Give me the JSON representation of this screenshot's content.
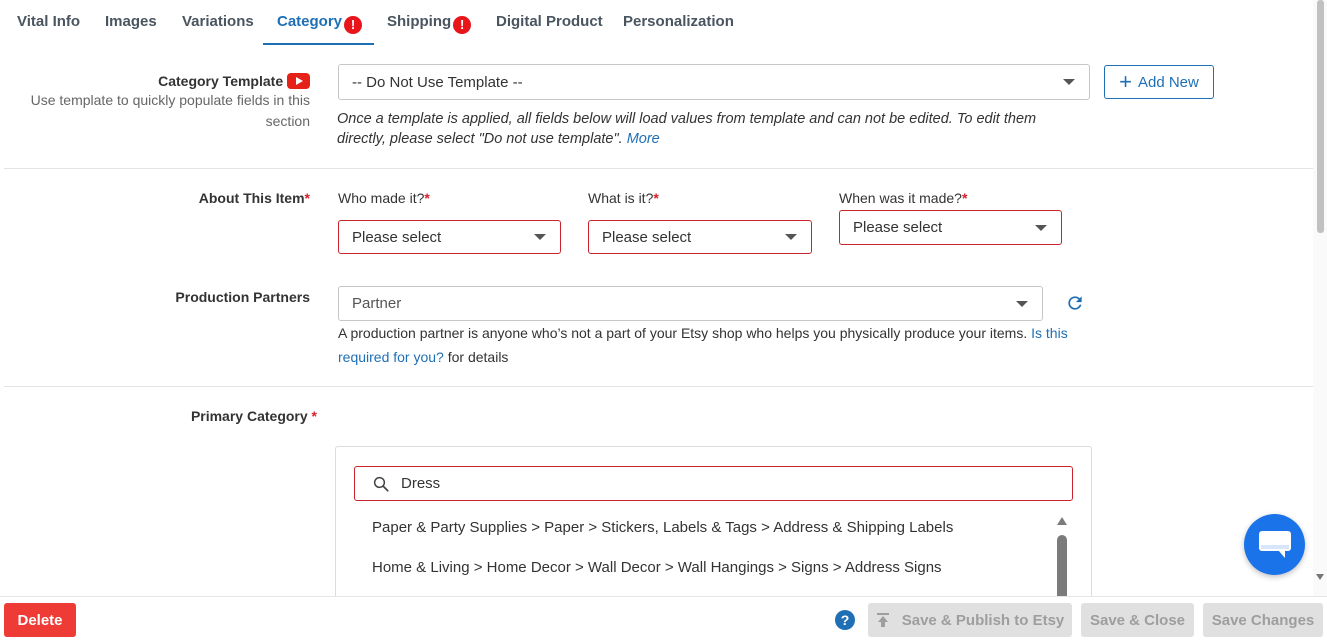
{
  "tabs": [
    {
      "label": "Vital Info"
    },
    {
      "label": "Images"
    },
    {
      "label": "Variations"
    },
    {
      "label": "Category",
      "alert": "!"
    },
    {
      "label": "Shipping",
      "alert": "!"
    },
    {
      "label": "Digital Product"
    },
    {
      "label": "Personalization"
    }
  ],
  "category_template": {
    "label": "Category Template",
    "hint_line1": "Use template to quickly populate fields in this",
    "hint_line2": "section",
    "selected": "-- Do Not Use Template --",
    "add_new": "Add New",
    "note": "Once a template is applied, all fields below will load values from template and can not be edited. To edit them directly, please select \"Do not use template\".",
    "more_link": "More"
  },
  "about_item": {
    "label": "About This Item",
    "req": "*",
    "who": {
      "label": "Who made it?",
      "req": "*",
      "value": "Please select"
    },
    "what": {
      "label": "What is it?",
      "req": "*",
      "value": "Please select"
    },
    "when": {
      "label": "When was it made?",
      "req": "*",
      "value": "Please select"
    }
  },
  "production_partners": {
    "label": "Production Partners",
    "placeholder": "Partner",
    "help_text": "A production partner is anyone who’s not a part of your Etsy shop who helps you physically produce your items.",
    "help_link": "Is this required for you?",
    "help_suffix": "for details"
  },
  "primary_category": {
    "label": "Primary Category",
    "req": "*",
    "search_value": "Dress",
    "results": [
      "Paper & Party Supplies > Paper > Stickers, Labels & Tags > Address & Shipping Labels",
      "Home & Living > Home Decor > Wall Decor > Wall Hangings > Signs > Address Signs"
    ]
  },
  "footer": {
    "delete": "Delete",
    "help_icon": "?",
    "publish": "Save & Publish to Etsy",
    "save_close": "Save & Close",
    "save_changes": "Save Changes"
  },
  "colors": {
    "accent": "#1f6fb5",
    "error": "#c9252c",
    "delete": "#ef3b36",
    "alert_badge": "#e8151b",
    "chat": "#1a73e8"
  }
}
